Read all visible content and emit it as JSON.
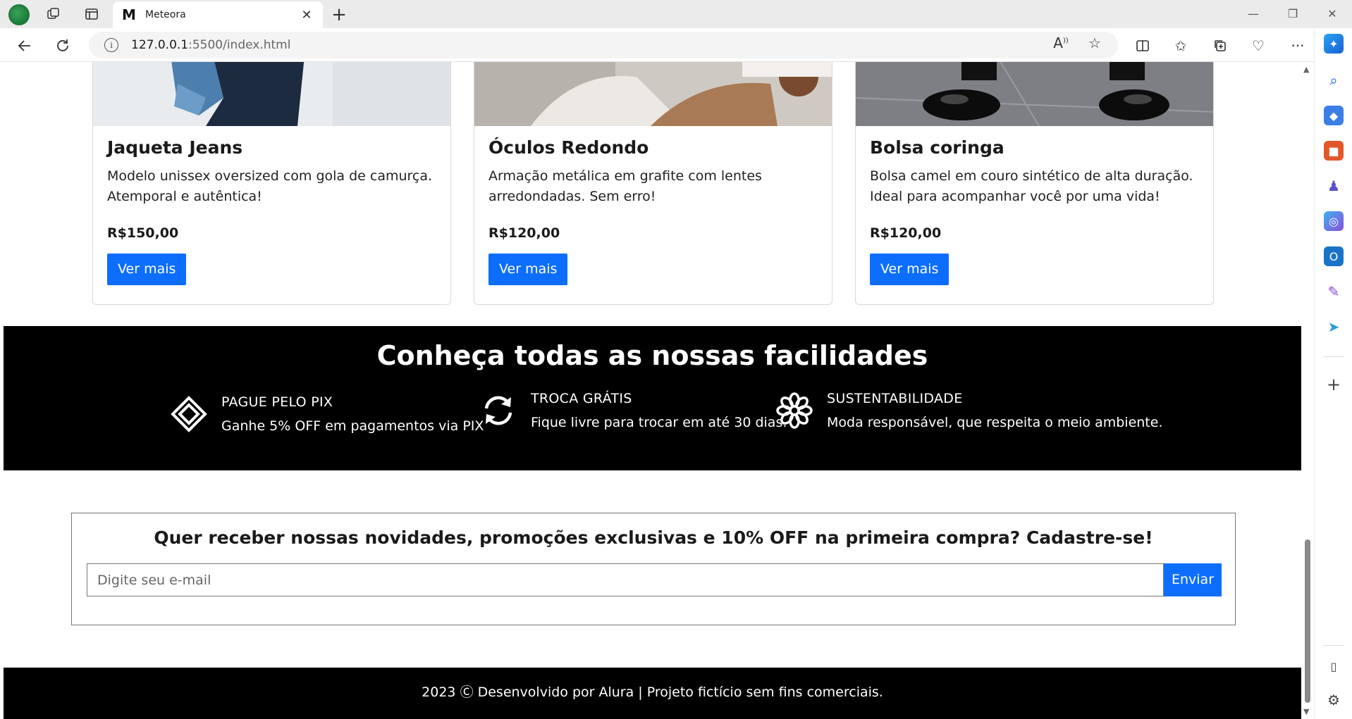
{
  "browser": {
    "tab_title": "Meteora",
    "tab_favicon": "M",
    "url_host": "127.0.0.1",
    "url_path": ":5500/index.html"
  },
  "products": [
    {
      "title": "Jaqueta Jeans",
      "description": "Modelo unissex oversized com gola de camurça. Atemporal e autêntica!",
      "price": "R$150,00",
      "button": "Ver mais"
    },
    {
      "title": "Óculos Redondo",
      "description": "Armação metálica em grafite com lentes arredondadas. Sem erro!",
      "price": "R$120,00",
      "button": "Ver mais"
    },
    {
      "title": "Bolsa coringa",
      "description": "Bolsa camel em couro sintético de alta duração. Ideal para acompanhar você por uma vida!",
      "price": "R$120,00",
      "button": "Ver mais"
    }
  ],
  "features": {
    "title": "Conheça todas as nossas facilidades",
    "items": [
      {
        "icon": "pix-icon",
        "name": "PAGUE PELO PIX",
        "description": "Ganhe 5% OFF em pagamentos via PIX"
      },
      {
        "icon": "exchange-icon",
        "name": "TROCA GRÁTIS",
        "description": "Fique livre para trocar em até 30 dias."
      },
      {
        "icon": "flower-icon",
        "name": "SUSTENTABILIDADE",
        "description": "Moda responsável, que respeita o meio ambiente."
      }
    ]
  },
  "newsletter": {
    "title": "Quer receber nossas novidades, promoções exclusivas e 10% OFF na primeira compra? Cadastre-se!",
    "placeholder": "Digite seu e-mail",
    "button": "Enviar"
  },
  "footer": {
    "text": "2023 Ⓒ Desenvolvido por Alura | Projeto fictício sem fins comerciais."
  },
  "colors": {
    "primary": "#0d6efd",
    "dark": "#000000"
  }
}
